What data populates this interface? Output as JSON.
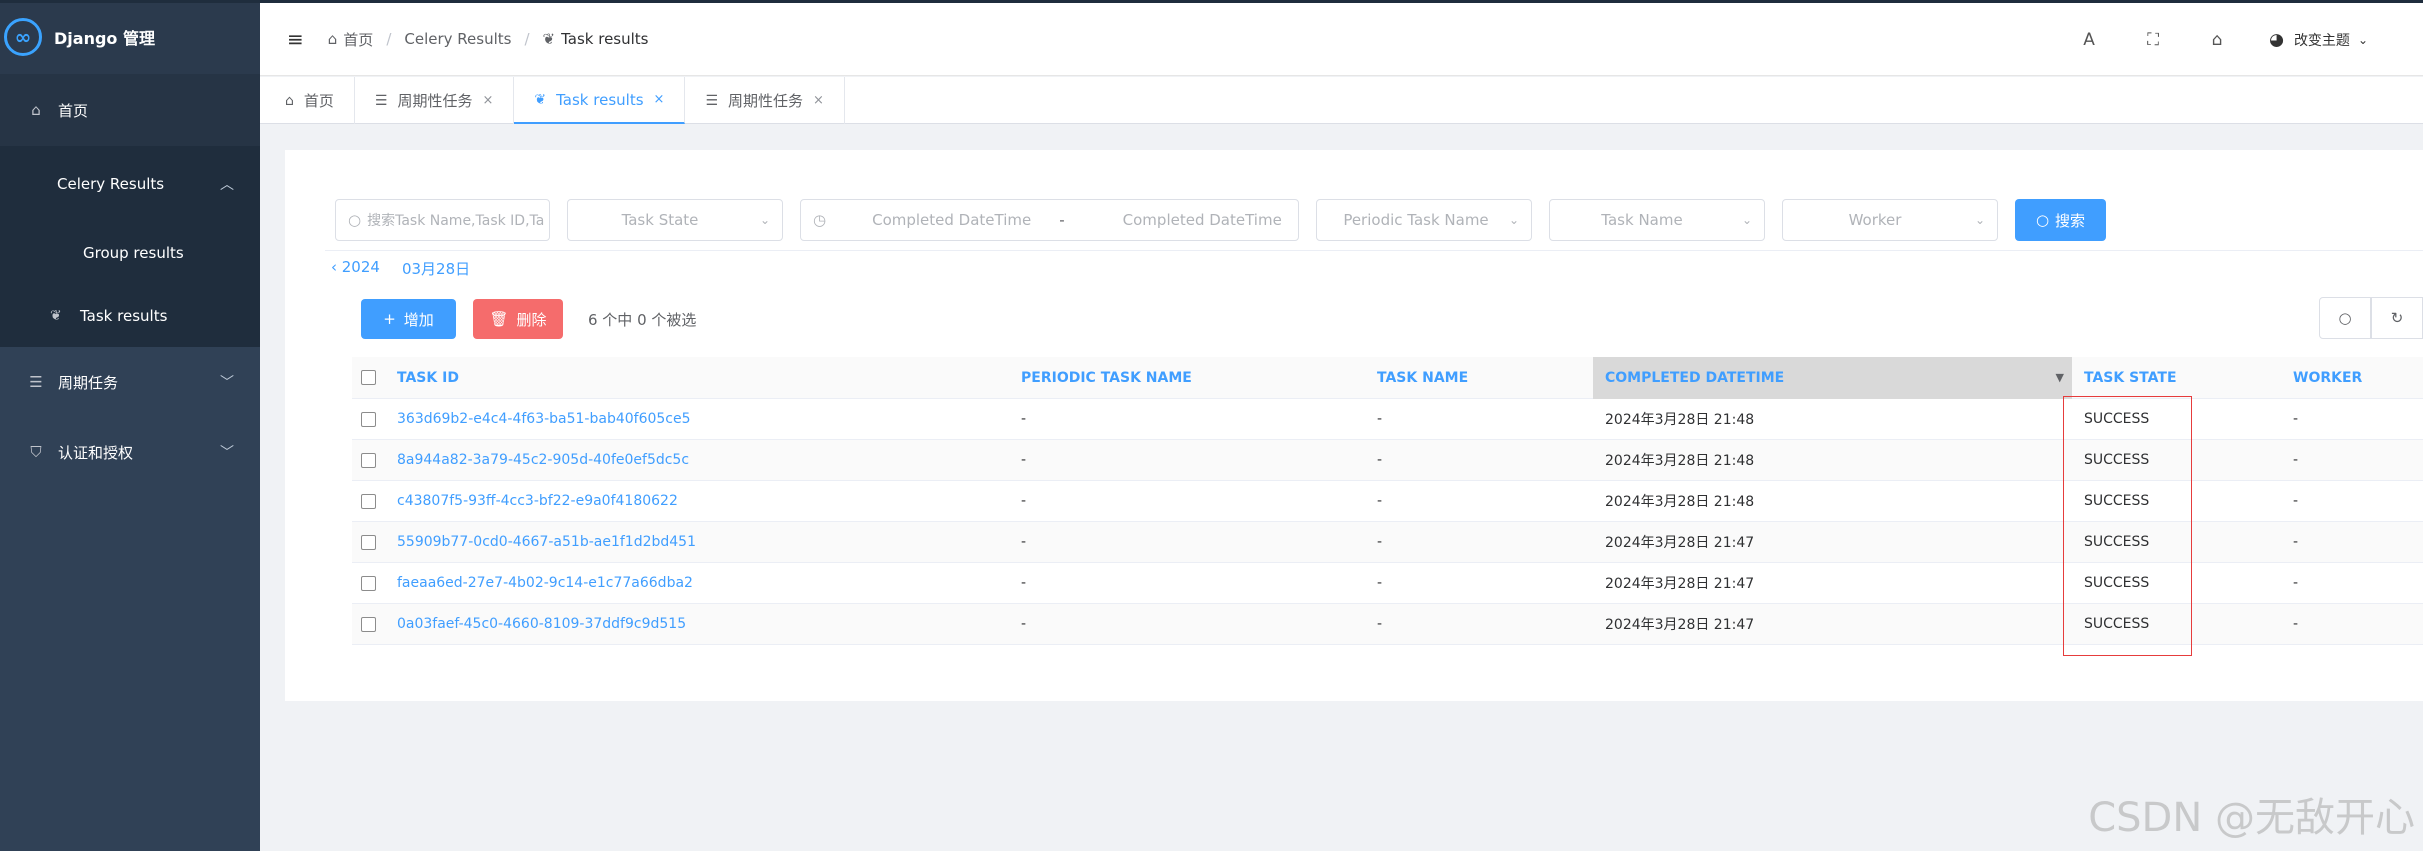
{
  "app": {
    "title": "Django 管理",
    "logo_glyph": "∞"
  },
  "sidebar": {
    "home": {
      "label": "首页",
      "icon": "home-icon"
    },
    "celery": {
      "label": "Celery Results",
      "icon": "chevron-up-icon",
      "items": [
        {
          "label": "Group results"
        },
        {
          "label": "Task results",
          "icon": "leaf-icon"
        }
      ]
    },
    "periodic": {
      "label": "周期任务",
      "icon": "list-icon"
    },
    "auth": {
      "label": "认证和授权",
      "icon": "shield-icon"
    }
  },
  "header": {
    "breadcrumb": [
      "首页",
      "Celery Results",
      "Task results"
    ],
    "theme_label": "改变主题"
  },
  "tabs": [
    {
      "label": "首页",
      "closable": false
    },
    {
      "label": "周期性任务",
      "closable": true
    },
    {
      "label": "Task results",
      "closable": true,
      "active": true
    },
    {
      "label": "周期性任务",
      "closable": true
    }
  ],
  "filters": {
    "search_placeholder": "搜索Task Name,Task ID,Ta",
    "task_state": "Task State",
    "completed_from": "Completed DateTime",
    "range_sep": "-",
    "completed_to": "Completed DateTime",
    "periodic_task_name": "Periodic Task Name",
    "task_name": "Task Name",
    "worker": "Worker",
    "search_button": "搜索"
  },
  "date_nav": {
    "year": "‹ 2024",
    "day": "03月28日"
  },
  "actions": {
    "add": "增加",
    "delete": "删除",
    "selection": "6 个中 0 个被选"
  },
  "table": {
    "columns": [
      "TASK ID",
      "PERIODIC TASK NAME",
      "TASK NAME",
      "COMPLETED DATETIME",
      "TASK STATE",
      "WORKER"
    ],
    "rows": [
      {
        "task_id": "363d69b2-e4c4-4f63-ba51-bab40f605ce5",
        "periodic": "-",
        "task_name": "-",
        "completed": "2024年3月28日 21:48",
        "state": "SUCCESS",
        "worker": "-"
      },
      {
        "task_id": "8a944a82-3a79-45c2-905d-40fe0ef5dc5c",
        "periodic": "-",
        "task_name": "-",
        "completed": "2024年3月28日 21:48",
        "state": "SUCCESS",
        "worker": "-"
      },
      {
        "task_id": "c43807f5-93ff-4cc3-bf22-e9a0f4180622",
        "periodic": "-",
        "task_name": "-",
        "completed": "2024年3月28日 21:48",
        "state": "SUCCESS",
        "worker": "-"
      },
      {
        "task_id": "55909b77-0cd0-4667-a51b-ae1f1d2bd451",
        "periodic": "-",
        "task_name": "-",
        "completed": "2024年3月28日 21:47",
        "state": "SUCCESS",
        "worker": "-"
      },
      {
        "task_id": "faeaa6ed-27e7-4b02-9c14-e1c77a66dba2",
        "periodic": "-",
        "task_name": "-",
        "completed": "2024年3月28日 21:47",
        "state": "SUCCESS",
        "worker": "-"
      },
      {
        "task_id": "0a03faef-45c0-4660-8109-37ddf9c9d515",
        "periodic": "-",
        "task_name": "-",
        "completed": "2024年3月28日 21:47",
        "state": "SUCCESS",
        "worker": "-"
      }
    ]
  },
  "watermark": "CSDN @无敌开心",
  "colors": {
    "accent": "#409eff",
    "danger": "#f56c6c",
    "sidebar": "#304156",
    "highlight_box": "#e63c3c"
  }
}
